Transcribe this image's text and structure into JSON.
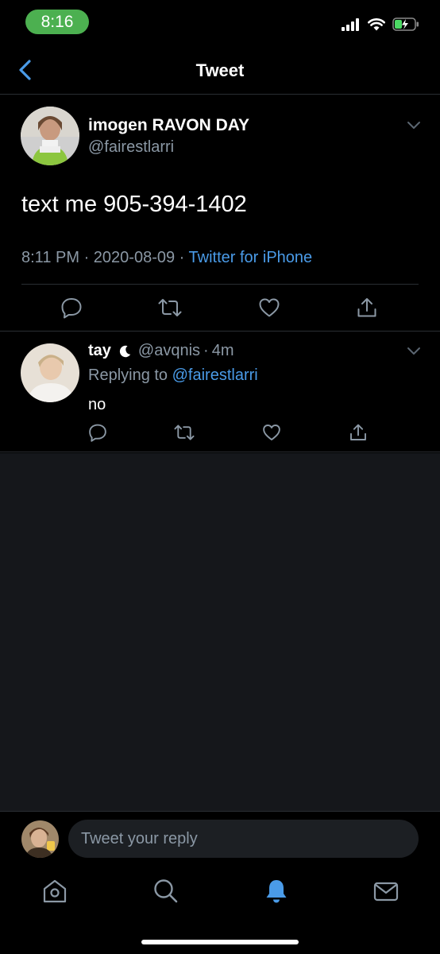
{
  "status_bar": {
    "time": "8:16",
    "time_pill_color": "#4cb050"
  },
  "header": {
    "title": "Tweet"
  },
  "main_tweet": {
    "author_name": "imogen RAVON DAY",
    "author_handle": "@fairestlarri",
    "text": "text me 905-394-1402",
    "time": "8:11 PM",
    "date": "2020-08-09",
    "separator": "·",
    "source": "Twitter for iPhone"
  },
  "reply": {
    "author_name": "tay",
    "author_handle": "@avqnis",
    "separator": "·",
    "age": "4m",
    "replying_to_label": "Replying to",
    "replying_to_handle": "@fairestlarri",
    "text": "no"
  },
  "composer": {
    "placeholder": "Tweet your reply"
  },
  "icons": [
    "back-chevron-icon",
    "caret-down-icon",
    "reply-icon",
    "retweet-icon",
    "like-icon",
    "share-icon",
    "moon-icon",
    "home-icon",
    "search-icon",
    "notifications-icon",
    "messages-icon"
  ],
  "colors": {
    "accent": "#4a9be8",
    "secondary_text": "#8b98a5",
    "background": "#000000",
    "divider": "#2a2e33"
  }
}
